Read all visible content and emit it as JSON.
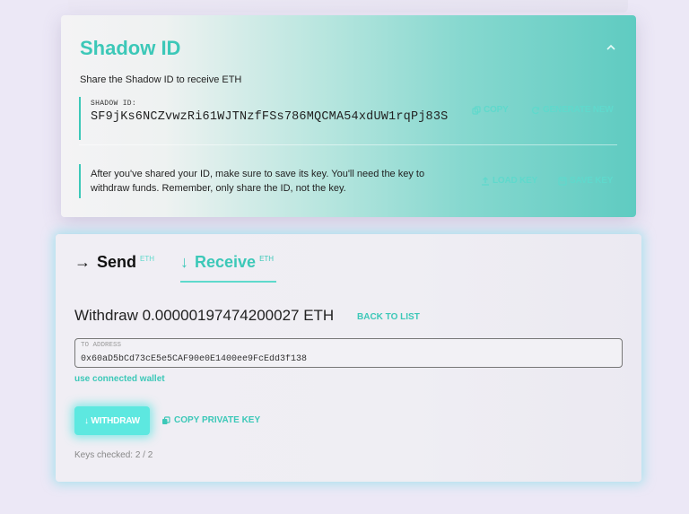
{
  "shadow": {
    "title": "Shadow ID",
    "subtitle": "Share the Shadow ID to receive ETH",
    "id_label": "SHADOW ID:",
    "id_value": "SF9jKs6NCZvwzRi61WJTNzfFSs786MQCMA54xdUW1rqPj83S",
    "copy_label": "COPY",
    "generate_label": "GENERATE NEW",
    "note": "After you've shared your ID, make sure to save its key. You'll need the key to withdraw funds. Remember, only share the ID, not the key.",
    "load_key_label": "LOAD KEY",
    "save_key_label": "SAVE KEY"
  },
  "tabs": [
    {
      "arrow": "→",
      "label": "Send",
      "sup": "ETH"
    },
    {
      "arrow": "↓",
      "label": "Receive",
      "sup": "ETH"
    }
  ],
  "withdraw": {
    "title": "Withdraw 0.00000197474200027 ETH",
    "back_label": "BACK TO LIST",
    "address_label": "TO ADDRESS",
    "address_value": "0x60aD5bCd73cE5e5CAF90e0E1400ee9FcEdd3f138",
    "connected_wallet_label": "use connected wallet",
    "withdraw_button": "↓ WITHDRAW",
    "copy_private_key": "COPY PRIVATE KEY",
    "keys_checked": "Keys checked: 2 / 2"
  },
  "colors": {
    "accent": "#3cc8b8",
    "button": "#5de8e0",
    "background": "#ece8f6"
  },
  "icons": [
    "chevron-up-icon",
    "copy-icon",
    "refresh-icon",
    "upload-icon",
    "save-icon",
    "arrow-right-icon",
    "arrow-down-icon"
  ]
}
